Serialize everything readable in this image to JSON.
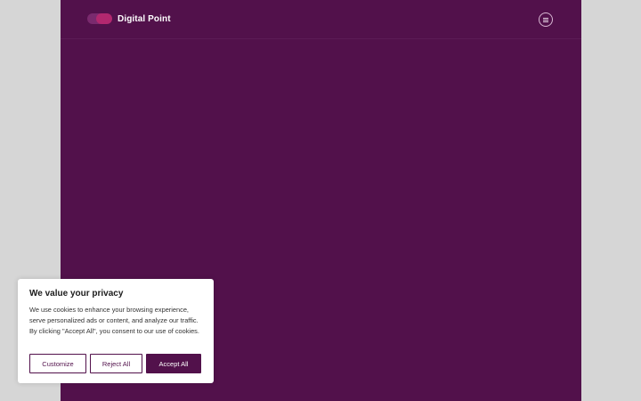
{
  "header": {
    "brand": "Digital Point",
    "menu_icon": "hamburger-menu-icon",
    "logo_colors": [
      "#7a2a6e",
      "#b2286f"
    ]
  },
  "theme": {
    "page_bg": "#52114b",
    "outer_bg": "#d6d6d6"
  },
  "cookie_banner": {
    "title": "We value your privacy",
    "text": "We use cookies to enhance your browsing experience, serve personalized ads or content, and analyze our traffic. By clicking \"Accept All\", you consent to our use of cookies.",
    "customize_label": "Customize",
    "reject_label": "Reject All",
    "accept_label": "Accept All"
  }
}
